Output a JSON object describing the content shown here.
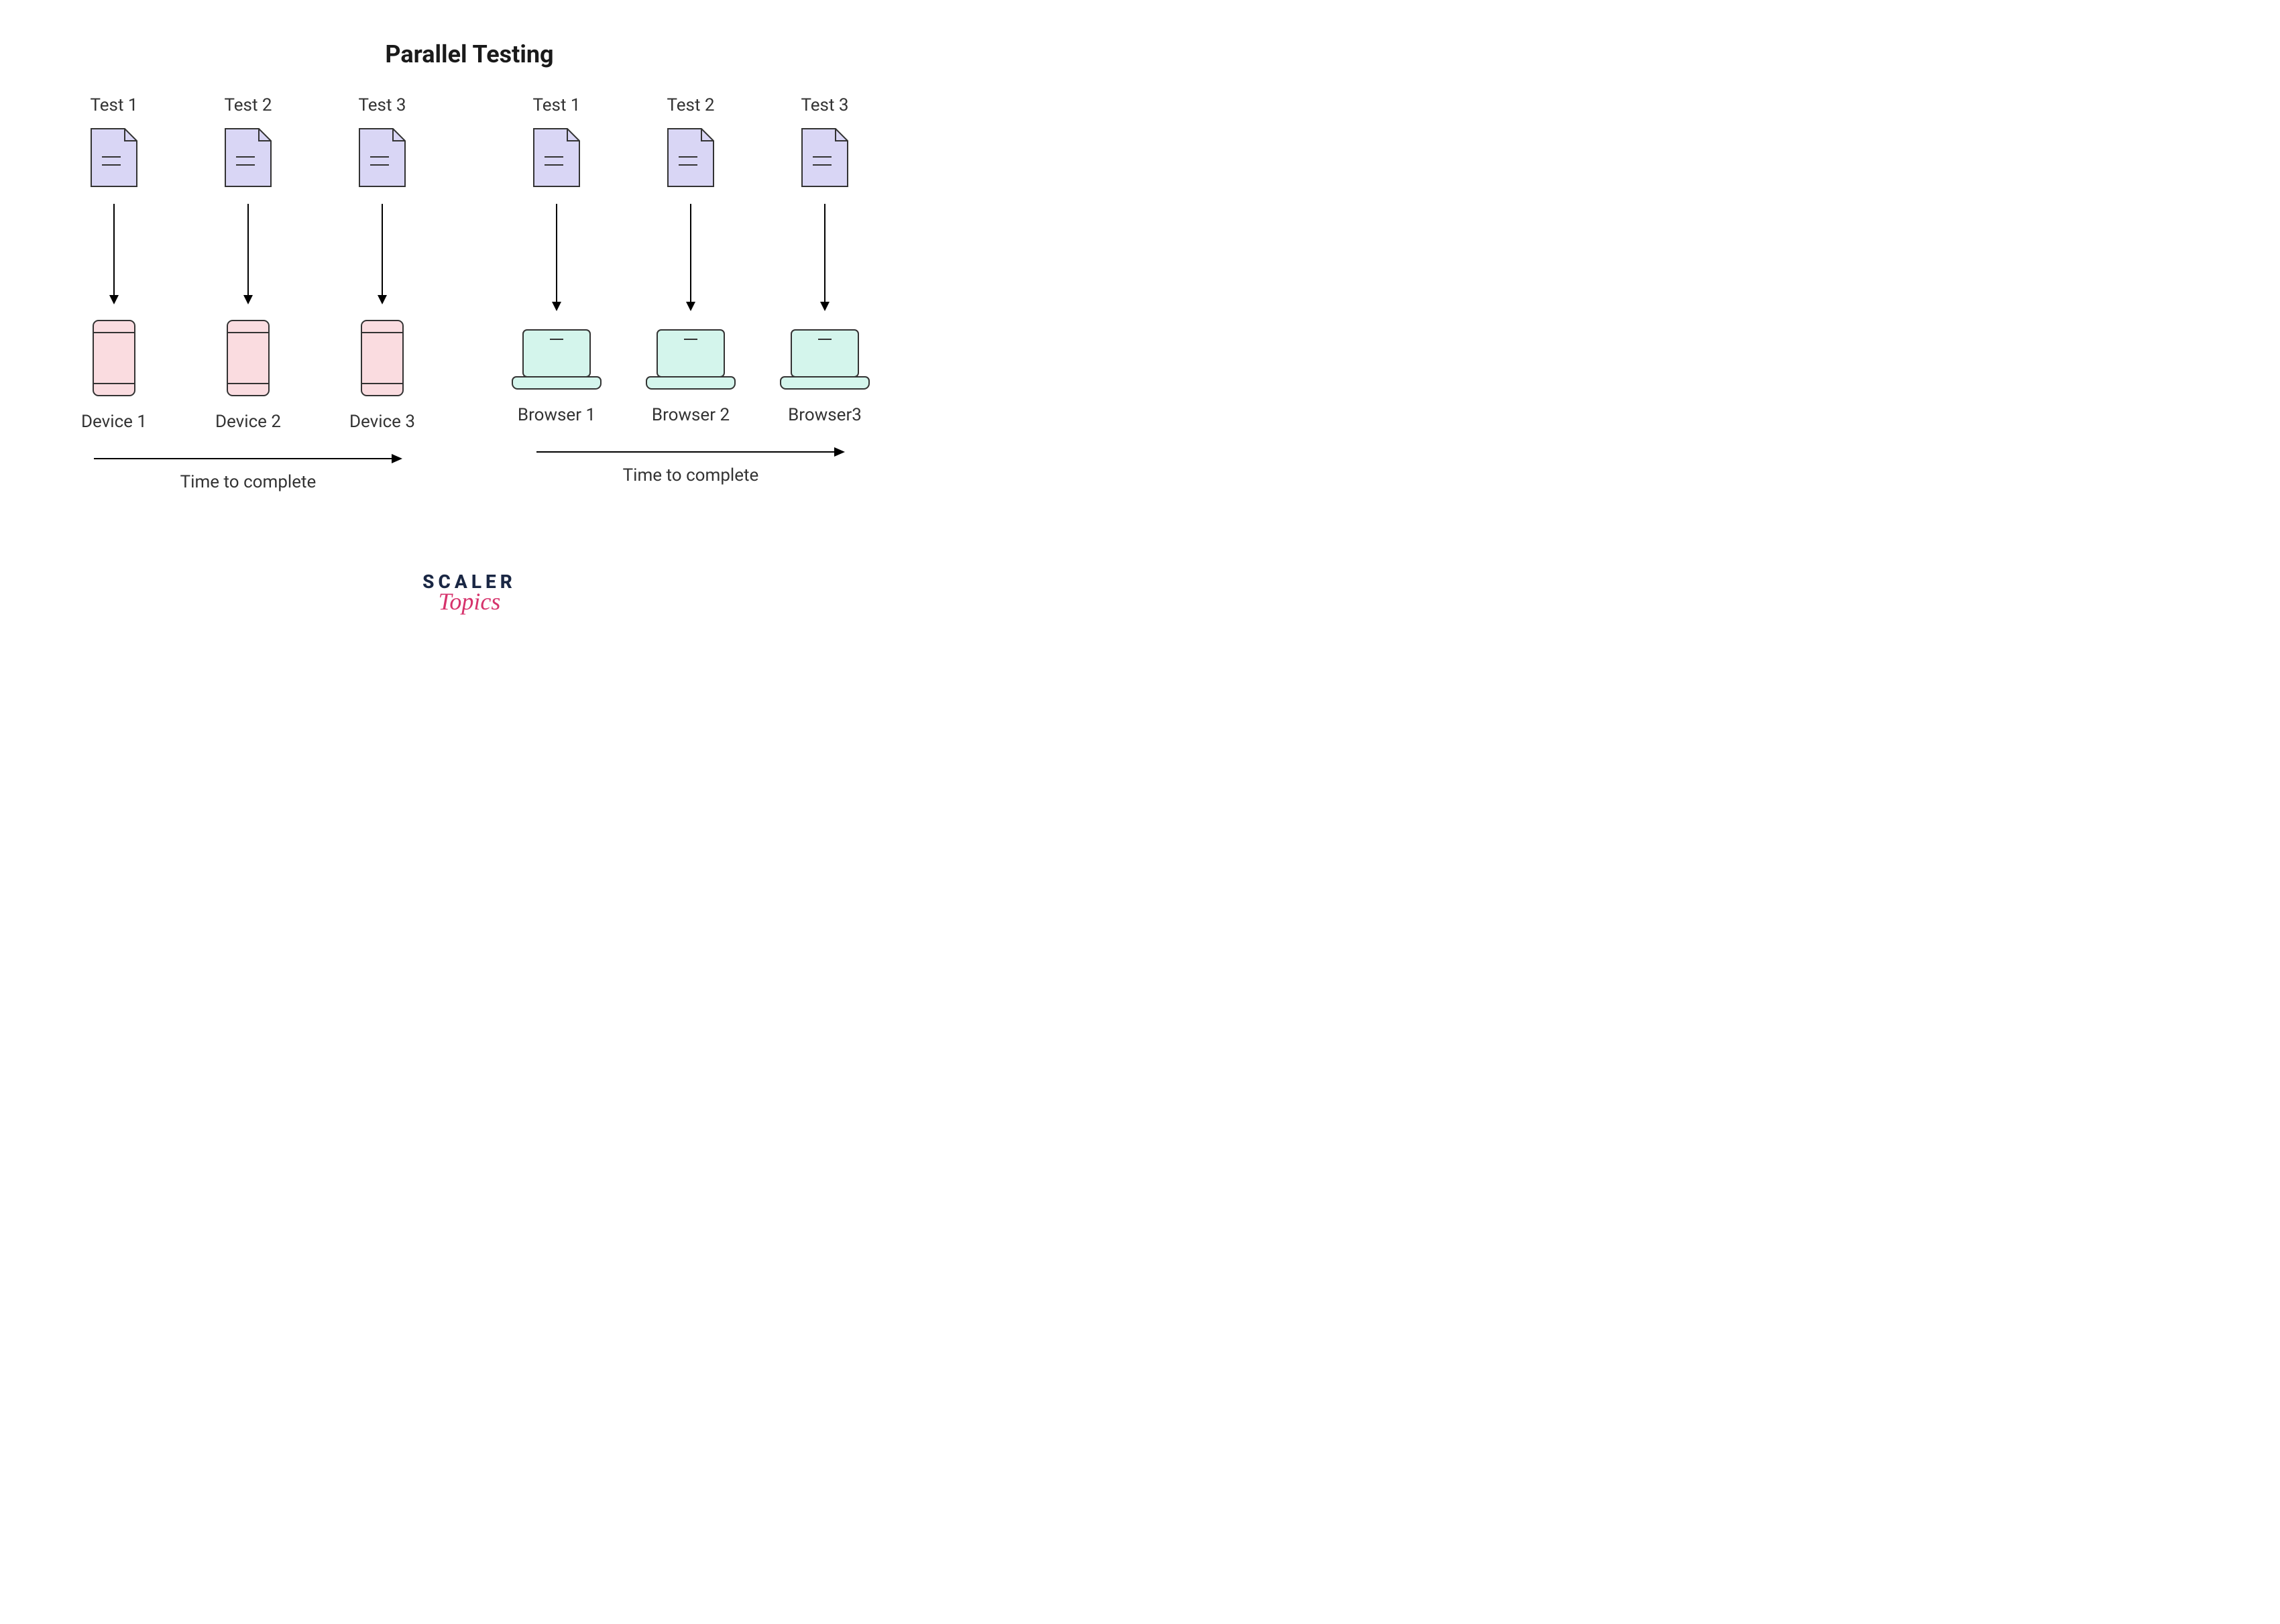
{
  "title": "Parallel Testing",
  "left": {
    "tests": [
      {
        "label": "Test 1",
        "target": "Device 1"
      },
      {
        "label": "Test 2",
        "target": "Device 2"
      },
      {
        "label": "Test 3",
        "target": "Device 3"
      }
    ],
    "time_label": "Time to complete"
  },
  "right": {
    "tests": [
      {
        "label": "Test 1",
        "target": "Browser 1"
      },
      {
        "label": "Test 2",
        "target": "Browser 2"
      },
      {
        "label": "Test 3",
        "target": "Browser3"
      }
    ],
    "time_label": "Time to complete"
  },
  "brand": {
    "main": "SCALER",
    "sub": "Topics"
  },
  "colors": {
    "file_fill": "#d9d6f5",
    "file_stroke": "#333",
    "device_fill": "#fadce0",
    "device_stroke": "#333",
    "laptop_fill": "#d4f5ec",
    "laptop_stroke": "#333"
  }
}
